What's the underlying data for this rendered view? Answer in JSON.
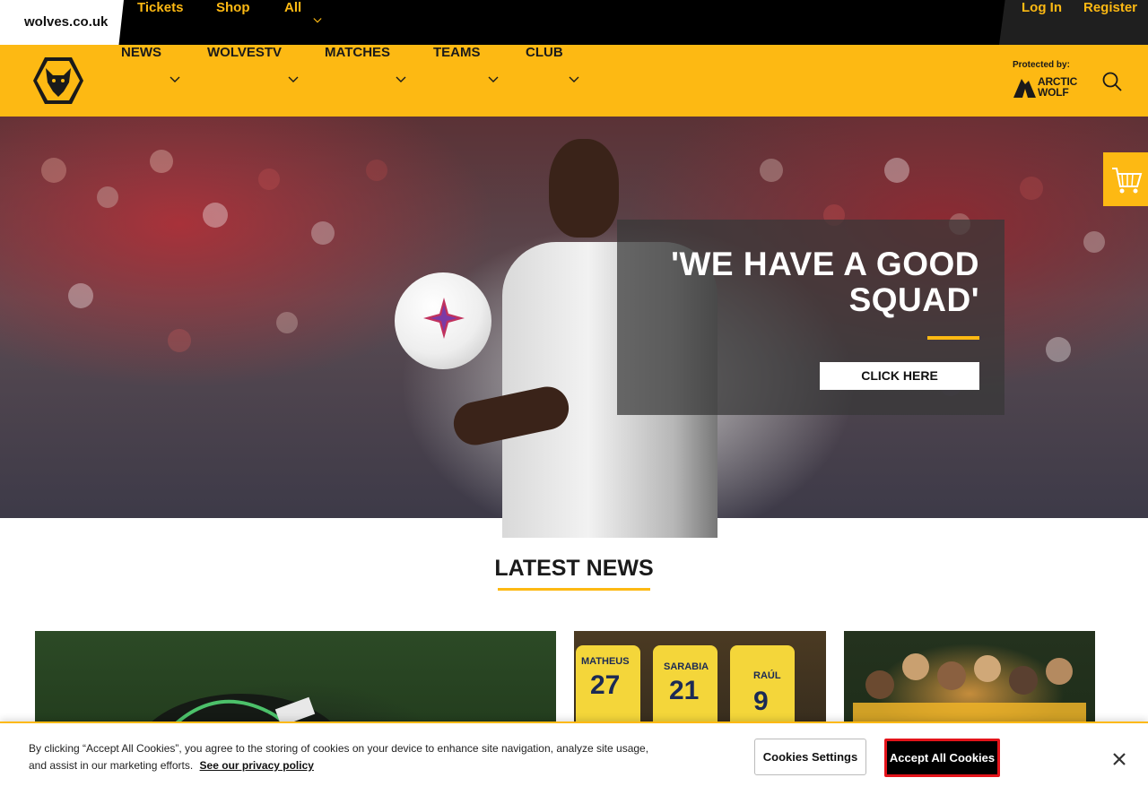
{
  "topbar": {
    "domain": "wolves.co.uk",
    "links": [
      "Tickets",
      "Shop",
      "All"
    ],
    "login": "Log In",
    "register": "Register"
  },
  "nav": {
    "items": [
      "NEWS",
      "WOLVESTV",
      "MATCHES",
      "TEAMS",
      "CLUB"
    ],
    "protected_by": "Protected by:",
    "sponsor_line1": "ARCTIC",
    "sponsor_line2": "WOLF"
  },
  "hero": {
    "title": "'WE HAVE A GOOD SQUAD'",
    "cta": "CLICK HERE"
  },
  "news": {
    "heading": "LATEST NEWS",
    "card_shirts": [
      {
        "name": "MATHEUS",
        "number": "27"
      },
      {
        "name": "SARABIA",
        "number": "21"
      },
      {
        "name": "RAÚL",
        "number": "9"
      }
    ]
  },
  "cookie": {
    "text": "By clicking “Accept All Cookies”, you agree to the storing of cookies on your device to enhance site navigation, analyze site usage, and assist in our marketing efforts.",
    "privacy_link": "See our privacy policy",
    "settings_label": "Cookies Settings",
    "accept_label": "Accept All Cookies"
  },
  "colors": {
    "brand_gold": "#fdb913",
    "black": "#000000",
    "accept_outline": "#e4141b"
  }
}
